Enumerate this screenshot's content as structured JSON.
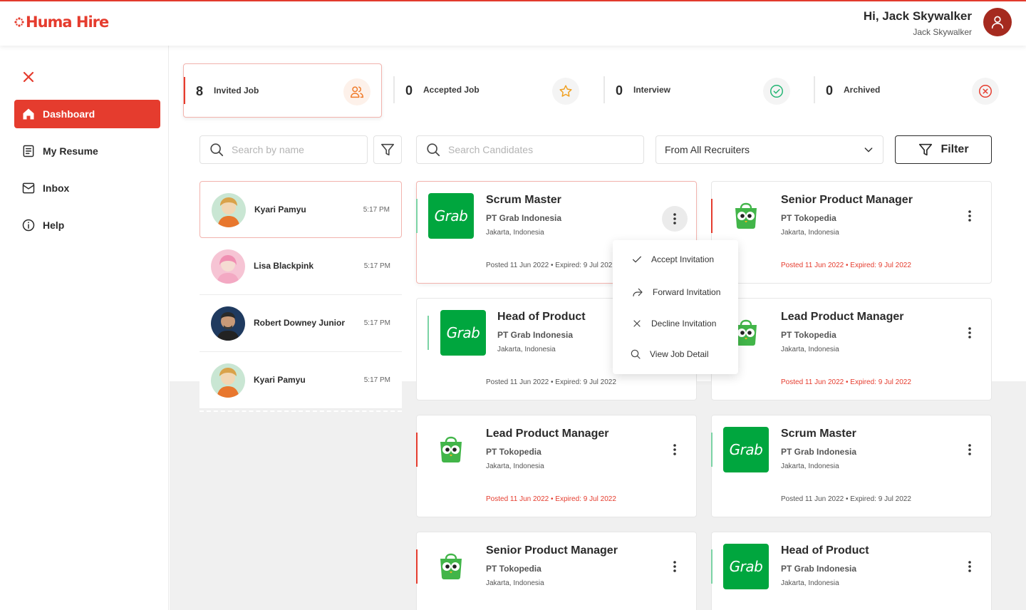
{
  "header": {
    "logo_text": "Huma Hire",
    "greeting": "Hi, Jack Skywalker",
    "username": "Jack Skywalker",
    "brand_color": "#e53c2e"
  },
  "sidebar": {
    "items": [
      {
        "label": "Dashboard",
        "icon": "home-icon",
        "active": true
      },
      {
        "label": "My Resume",
        "icon": "document-icon"
      },
      {
        "label": "Inbox",
        "icon": "mail-icon"
      },
      {
        "label": "Help",
        "icon": "info-icon"
      }
    ]
  },
  "stats": [
    {
      "count": "8",
      "label": "Invited Job",
      "icon": "users-icon"
    },
    {
      "count": "0",
      "label": "Accepted Job",
      "icon": "star-icon"
    },
    {
      "count": "0",
      "label": "Interview",
      "icon": "check-circle-icon"
    },
    {
      "count": "0",
      "label": "Archived",
      "icon": "x-circle-icon"
    }
  ],
  "search": {
    "name_placeholder": "Search by name",
    "candidates_placeholder": "Search Candidates",
    "recruiter_select": "From All Recruiters",
    "filter_label": "Filter"
  },
  "candidates": [
    {
      "name": "Kyari Pamyu",
      "time": "5:17 PM"
    },
    {
      "name": "Lisa Blackpink",
      "time": "5:17 PM"
    },
    {
      "name": "Robert Downey Junior",
      "time": "5:17 PM"
    },
    {
      "name": "Kyari Pamyu",
      "time": "5:17 PM"
    }
  ],
  "jobs": [
    {
      "title": "Scrum Master",
      "company": "PT Grab Indonesia",
      "location": "Jakarta, Indonesia",
      "dates": "Posted 11 Jun 2022  •  Expired: 9 Jul 2022"
    },
    {
      "title": "Senior Product Manager",
      "company": "PT Tokopedia",
      "location": "Jakarta, Indonesia",
      "dates": "Posted 11 Jun 2022  •  Expired: 9 Jul 2022"
    },
    {
      "title": "Head of Product",
      "company": "PT Grab Indonesia",
      "location": "Jakarta, Indonesia",
      "dates": "Posted 11 Jun 2022  •  Expired: 9 Jul 2022"
    },
    {
      "title": "Lead Product Manager",
      "company": "PT Tokopedia",
      "location": "Jakarta, Indonesia",
      "dates": "Posted 11 Jun 2022  •  Expired: 9 Jul 2022"
    },
    {
      "title": "Lead Product Manager",
      "company": "PT Tokopedia",
      "location": "Jakarta, Indonesia",
      "dates": "Posted 11 Jun 2022  •  Expired: 9 Jul 2022"
    },
    {
      "title": "Scrum Master",
      "company": "PT Grab Indonesia",
      "location": "Jakarta, Indonesia",
      "dates": "Posted 11 Jun 2022  •  Expired: 9 Jul 2022"
    },
    {
      "title": "Senior Product Manager",
      "company": "PT Tokopedia",
      "location": "Jakarta, Indonesia"
    },
    {
      "title": "Head of Product",
      "company": "PT Grab Indonesia",
      "location": "Jakarta, Indonesia"
    }
  ],
  "grab_logo_text": "Grab",
  "menu": {
    "items": [
      {
        "label": "Accept Invitation",
        "icon": "check-icon"
      },
      {
        "label": "Forward Invitation",
        "icon": "forward-icon"
      },
      {
        "label": "Decline Invitation",
        "icon": "close-icon"
      },
      {
        "label": "View Job Detail",
        "icon": "search-icon"
      }
    ]
  },
  "colors": {
    "accent_red": "#e53c2e",
    "accent_green": "#7bd3a5",
    "grab_green": "#00a63e",
    "tokopedia_green": "#42b549"
  }
}
